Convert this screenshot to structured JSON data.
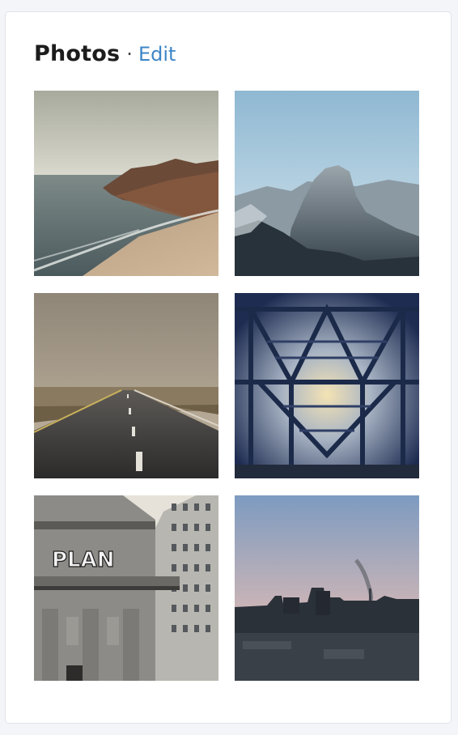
{
  "widget": {
    "title": "Photos",
    "separator": "·",
    "edit_label": "Edit"
  },
  "photos": [
    {
      "alt": "coastal cliffs and beach"
    },
    {
      "alt": "granite dome mountain"
    },
    {
      "alt": "desert highway in fog"
    },
    {
      "alt": "steel bridge truss at sunset"
    },
    {
      "alt": "building with graffiti"
    },
    {
      "alt": "city skyline at dusk"
    }
  ],
  "graffiti_text": "PLAN"
}
